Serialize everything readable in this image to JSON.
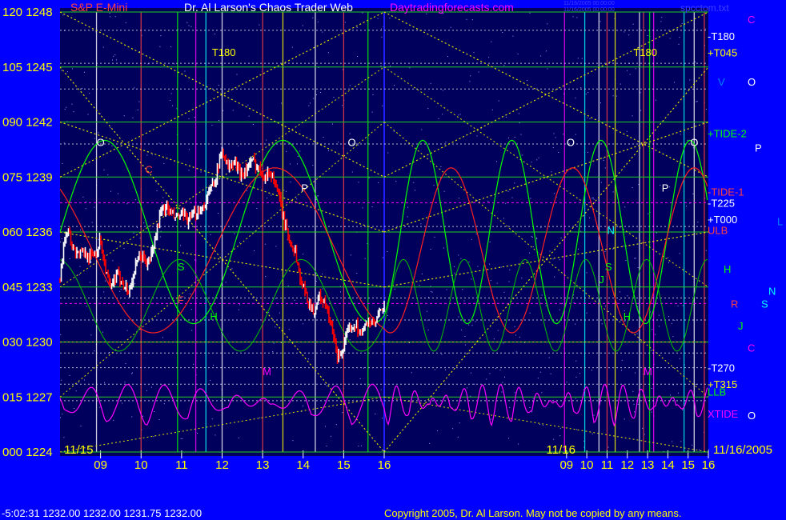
{
  "header": {
    "instrument": "S&P E-Mini",
    "title": "Dr. Al Larson's Chaos Trader Web",
    "site": "Daytradingforecasts.com",
    "stamp1": "11/16/2005 00:00:00",
    "stamp2": "11/16/2005 00:00:00",
    "file": "spcctom.txt"
  },
  "footer": {
    "quote": "-5:02:31   1232.00  1232.00  1231.75  1232.00",
    "copyright": "Copyright 2005, Dr. Al Larson. May not be copied by any means."
  },
  "chart_data": {
    "type": "candlestick",
    "left_axis_labels": [
      {
        "angle": "120",
        "price": "1248"
      },
      {
        "angle": "105",
        "price": "1245"
      },
      {
        "angle": "090",
        "price": "1242"
      },
      {
        "angle": "075",
        "price": "1239"
      },
      {
        "angle": "060",
        "price": "1236"
      },
      {
        "angle": "045",
        "price": "1233"
      },
      {
        "angle": "030",
        "price": "1230"
      },
      {
        "angle": "015",
        "price": "1227"
      },
      {
        "angle": "000",
        "price": "1224"
      }
    ],
    "ylim": [
      1224,
      1248
    ],
    "x_ticks": [
      {
        "label": "09",
        "x": 9
      },
      {
        "label": "10",
        "x": 10
      },
      {
        "label": "11",
        "x": 11
      },
      {
        "label": "12",
        "x": 12
      },
      {
        "label": "13",
        "x": 13
      },
      {
        "label": "14",
        "x": 14
      },
      {
        "label": "15",
        "x": 15
      },
      {
        "label": "16",
        "x": 16
      },
      {
        "label": "09",
        "x": 25
      },
      {
        "label": "10",
        "x": 26
      },
      {
        "label": "11",
        "x": 27
      },
      {
        "label": "12",
        "x": 28
      },
      {
        "label": "13",
        "x": 29
      },
      {
        "label": "14",
        "x": 30
      },
      {
        "label": "15",
        "x": 31
      },
      {
        "label": "16",
        "x": 32
      }
    ],
    "date_labels": [
      {
        "text": "11/15",
        "x": 8.1
      },
      {
        "text": "11/16",
        "x": 24.0
      },
      {
        "text": "11/16/2005",
        "x": 32.5
      }
    ],
    "xlim": [
      8,
      32
    ],
    "price_path": [
      [
        8.0,
        1233.3
      ],
      [
        8.1,
        1235.6
      ],
      [
        8.2,
        1236.3
      ],
      [
        8.3,
        1235.2
      ],
      [
        8.45,
        1234.8
      ],
      [
        8.6,
        1234.9
      ],
      [
        8.75,
        1234.6
      ],
      [
        8.9,
        1235.0
      ],
      [
        9.0,
        1235.6
      ],
      [
        9.1,
        1234.2
      ],
      [
        9.25,
        1232.8
      ],
      [
        9.4,
        1233.7
      ],
      [
        9.55,
        1233.3
      ],
      [
        9.7,
        1232.7
      ],
      [
        9.85,
        1234.0
      ],
      [
        10.0,
        1234.8
      ],
      [
        10.15,
        1234.2
      ],
      [
        10.3,
        1235.1
      ],
      [
        10.45,
        1236.8
      ],
      [
        10.6,
        1237.4
      ],
      [
        10.8,
        1236.8
      ],
      [
        11.0,
        1236.9
      ],
      [
        11.2,
        1236.6
      ],
      [
        11.4,
        1237.2
      ],
      [
        11.55,
        1237.4
      ],
      [
        11.7,
        1238.3
      ],
      [
        11.85,
        1239.0
      ],
      [
        12.0,
        1240.5
      ],
      [
        12.15,
        1239.5
      ],
      [
        12.3,
        1239.8
      ],
      [
        12.45,
        1239.2
      ],
      [
        12.6,
        1239.4
      ],
      [
        12.75,
        1239.9
      ],
      [
        12.9,
        1239.5
      ],
      [
        13.05,
        1239.1
      ],
      [
        13.2,
        1239.2
      ],
      [
        13.35,
        1238.5
      ],
      [
        13.5,
        1236.8
      ],
      [
        13.65,
        1235.6
      ],
      [
        13.8,
        1235.0
      ],
      [
        13.95,
        1233.2
      ],
      [
        14.1,
        1232.4
      ],
      [
        14.25,
        1231.6
      ],
      [
        14.4,
        1232.5
      ],
      [
        14.55,
        1232.0
      ],
      [
        14.7,
        1230.8
      ],
      [
        14.85,
        1229.2
      ],
      [
        15.0,
        1229.7
      ],
      [
        15.15,
        1230.8
      ],
      [
        15.3,
        1231.0
      ],
      [
        15.45,
        1230.4
      ],
      [
        15.6,
        1231.2
      ],
      [
        15.75,
        1230.9
      ],
      [
        15.9,
        1231.6
      ],
      [
        16.0,
        1232.0
      ]
    ],
    "annotations": [
      {
        "text": "T180",
        "x": 11.75,
        "y": 1245.6,
        "color": "#ffff00"
      },
      {
        "text": "T180",
        "x": 28.3,
        "y": 1245.6,
        "color": "#ffff00"
      },
      {
        "text": "O",
        "x": 8.9,
        "y": 1240.7,
        "color": "#ffffff"
      },
      {
        "text": "O",
        "x": 15.1,
        "y": 1240.7,
        "color": "#ffffff"
      },
      {
        "text": "O",
        "x": 25.0,
        "y": 1240.7,
        "color": "#ffffff"
      },
      {
        "text": "O",
        "x": 31.1,
        "y": 1240.7,
        "color": "#ffffff"
      },
      {
        "text": "C",
        "x": 10.1,
        "y": 1239.2,
        "color": "#ff4040"
      },
      {
        "text": "P",
        "x": 13.95,
        "y": 1238.2,
        "color": "#ffffff"
      },
      {
        "text": "P",
        "x": 29.7,
        "y": 1238.2,
        "color": "#ffffff"
      },
      {
        "text": "N",
        "x": 27.0,
        "y": 1235.9,
        "color": "#00ffff"
      },
      {
        "text": "S",
        "x": 10.9,
        "y": 1233.9,
        "color": "#00ff00"
      },
      {
        "text": "S",
        "x": 26.9,
        "y": 1233.9,
        "color": "#00ff00"
      },
      {
        "text": "H",
        "x": 11.7,
        "y": 1231.2,
        "color": "#00ff00"
      },
      {
        "text": "H",
        "x": 27.8,
        "y": 1231.2,
        "color": "#00ff00"
      },
      {
        "text": "F",
        "x": 10.9,
        "y": 1232.1,
        "color": "#ff4040"
      },
      {
        "text": "J",
        "x": 26.6,
        "y": 1233.2,
        "color": "#00ff00"
      },
      {
        "text": "M",
        "x": 13.0,
        "y": 1228.2,
        "color": "#ff00ff"
      },
      {
        "text": "M",
        "x": 28.8,
        "y": 1228.2,
        "color": "#ff00ff"
      }
    ],
    "right_labels": [
      {
        "text": "C",
        "y": 1247.6,
        "color": "#ff00ff"
      },
      {
        "text": "-T180",
        "y": 1246.7,
        "color": "#ffffff"
      },
      {
        "text": "+T045",
        "y": 1245.8,
        "color": "#ffff00"
      },
      {
        "text": "V",
        "y": 1244.2,
        "color": "#0080ff"
      },
      {
        "text": "O",
        "y": 1244.2,
        "color": "#ffffff"
      },
      {
        "text": "+TIDE-2",
        "y": 1241.4,
        "color": "#00ff00"
      },
      {
        "text": "P",
        "y": 1240.6,
        "color": "#ffffff"
      },
      {
        "text": "-TIDE-1",
        "y": 1238.2,
        "color": "#ff4040"
      },
      {
        "text": "-T225",
        "y": 1237.6,
        "color": "#ffffff"
      },
      {
        "text": "L",
        "y": 1236.6,
        "color": "#0080ff"
      },
      {
        "text": "+T000",
        "y": 1236.7,
        "color": "#ffffff"
      },
      {
        "text": "ULB",
        "y": 1236.1,
        "color": "#ff4040"
      },
      {
        "text": "H",
        "y": 1234.0,
        "color": "#00ff00"
      },
      {
        "text": "N",
        "y": 1232.8,
        "color": "#00ffff"
      },
      {
        "text": "R",
        "y": 1232.1,
        "color": "#ff4040"
      },
      {
        "text": "S",
        "y": 1232.1,
        "color": "#00ffff"
      },
      {
        "text": "J",
        "y": 1230.9,
        "color": "#00ff00"
      },
      {
        "text": "C",
        "y": 1229.7,
        "color": "#ff00ff"
      },
      {
        "text": "-T270",
        "y": 1228.6,
        "color": "#ffffff"
      },
      {
        "text": "+T315",
        "y": 1227.7,
        "color": "#ffff00"
      },
      {
        "text": "LLB",
        "y": 1227.3,
        "color": "#00ff00"
      },
      {
        "text": "XTIDE",
        "y": 1226.1,
        "color": "#ff00ff"
      },
      {
        "text": "O",
        "y": 1226.0,
        "color": "#ffffff"
      }
    ],
    "colors": {
      "background": "#0000ff",
      "plot_area": "#00005c",
      "axis_text": "#ffff00",
      "up_bar": "#ffffff",
      "down_bar": "#ff0000",
      "title": "#ffffff",
      "site": "#ff00ff",
      "tide2": "#00ff00",
      "tide1": "#ff2020",
      "xtide": "#ff00ff"
    }
  }
}
